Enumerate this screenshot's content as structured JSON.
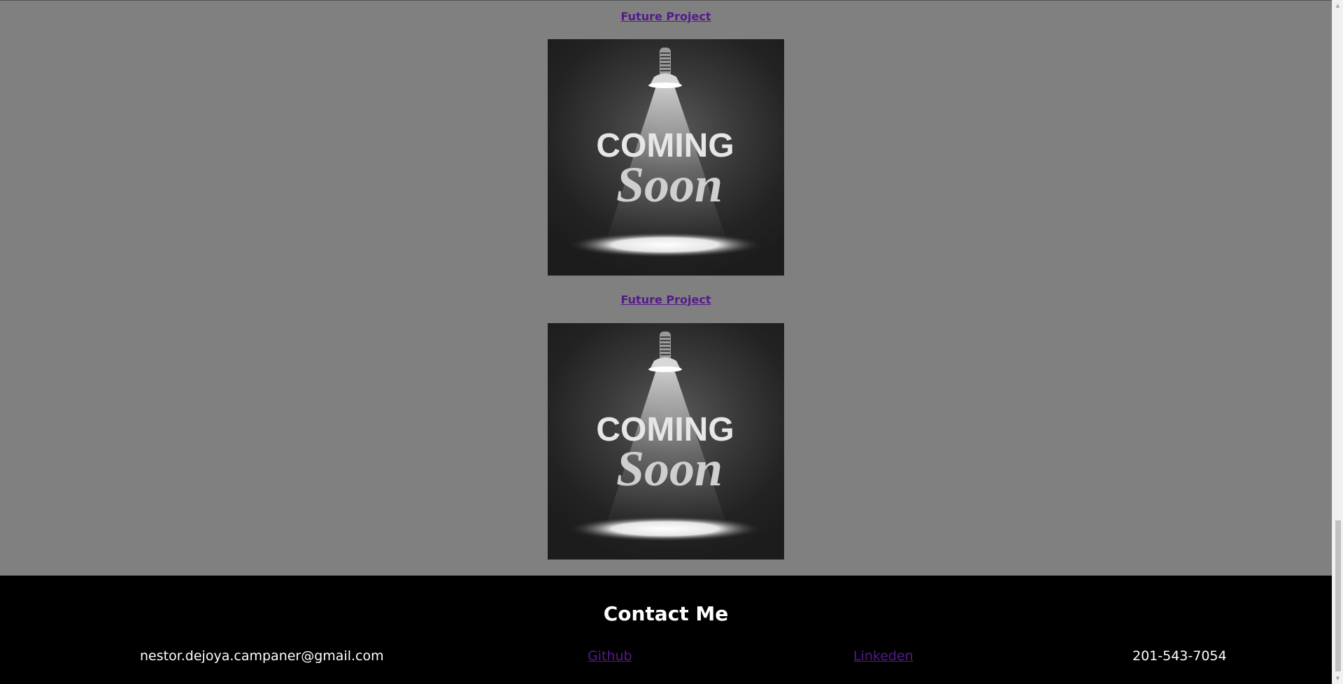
{
  "projects": [
    {
      "link_label": "Future Project",
      "poster_line1": "COMING",
      "poster_line2": "Soon"
    },
    {
      "link_label": "Future Project",
      "poster_line1": "COMING",
      "poster_line2": "Soon"
    }
  ],
  "footer": {
    "title": "Contact Me",
    "email": "nestor.dejoya.campaner@gmail.com",
    "github_label": "Github",
    "linkedin_label": "Linkeden",
    "phone": "201-543-7054"
  },
  "icons": {
    "poster_art": "spotlight-lamp-icon",
    "scroll_up": "triangle-up-icon",
    "scroll_down": "triangle-down-icon"
  },
  "colors": {
    "page_bg": "#808080",
    "footer_bg": "#000000",
    "link": "#551a8b",
    "footer_text": "#ffffff"
  }
}
